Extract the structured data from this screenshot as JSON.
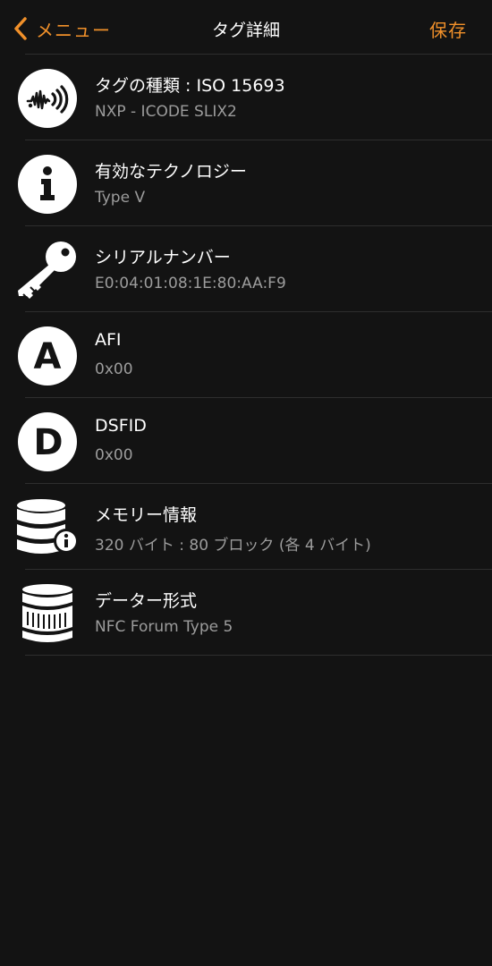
{
  "nav": {
    "back_label": "メニュー",
    "title": "タグ詳細",
    "save_label": "保存",
    "accent_color": "#f0902a"
  },
  "rows": [
    {
      "icon": "sound-wave-icon",
      "title": "タグの種類 : ISO 15693",
      "value": "NXP - ICODE SLIX2"
    },
    {
      "icon": "info-icon",
      "title": "有効なテクノロジー",
      "value": "Type V"
    },
    {
      "icon": "key-icon",
      "title": "シリアルナンバー",
      "value": "E0:04:01:08:1E:80:AA:F9"
    },
    {
      "icon": "letter-a-icon",
      "title": "AFI",
      "value": "0x00",
      "letter": "A"
    },
    {
      "icon": "letter-d-icon",
      "title": "DSFID",
      "value": "0x00",
      "letter": "D"
    },
    {
      "icon": "database-info-icon",
      "title": "メモリー情報",
      "value": "320 バイト : 80 ブロック (各 4 バイト)"
    },
    {
      "icon": "coin-stack-icon",
      "title": "データー形式",
      "value": "NFC Forum Type 5"
    }
  ]
}
